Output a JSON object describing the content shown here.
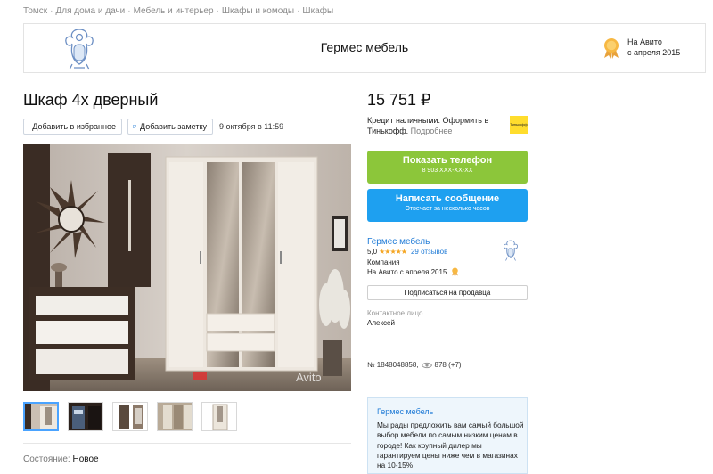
{
  "breadcrumbs": [
    "Томск",
    "Для дома и дачи",
    "Мебель и интерьер",
    "Шкафы и комоды",
    "Шкафы"
  ],
  "shop": {
    "name": "Гермес мебель",
    "since_line1": "На Авито",
    "since_line2": "с апреля 2015"
  },
  "listing": {
    "title": "Шкаф 4х дверный",
    "add_favorite": "Добавить в избранное",
    "add_note": "Добавить заметку",
    "date": "9 октября в 11:59",
    "watermark": "Avito",
    "condition_label": "Состояние:",
    "condition_value": "Новое",
    "thumbnail_count": 5
  },
  "sidebar": {
    "price": "15 751 ₽",
    "credit_text": "Кредит наличными. Оформить в Тинькофф.",
    "credit_more": "Подробнее",
    "tinkoff_badge": "Тинькофф",
    "phone_button": "Показать телефон",
    "phone_masked": "8 903 XXX-XX-XX",
    "message_button": "Написать сообщение",
    "message_sub": "Отвечает за несколько часов",
    "seller": {
      "name": "Гермес мебель",
      "rating": "5,0",
      "stars": "★★★★★",
      "reviews": "29 отзывов",
      "type": "Компания",
      "since": "На Авито с апреля 2015"
    },
    "subscribe": "Подписаться на продавца",
    "contact_label": "Контактное лицо",
    "contact_name": "Алексей",
    "ad_number": "№ 1848048858,",
    "views": "878 (+7)"
  },
  "promo": {
    "title": "Гермес мебель",
    "text": "Мы рады предложить вам самый большой выбор мебели по самым низким ценам в городе! Как крупный дилер мы гарантируем цены ниже чем в магазинах на 10-15%"
  },
  "colors": {
    "phone_green": "#8cc63a",
    "message_blue": "#1ea0f0",
    "link_blue": "#1e7ad6",
    "star_orange": "#f5a623",
    "tinkoff_yellow": "#ffdd2d"
  }
}
